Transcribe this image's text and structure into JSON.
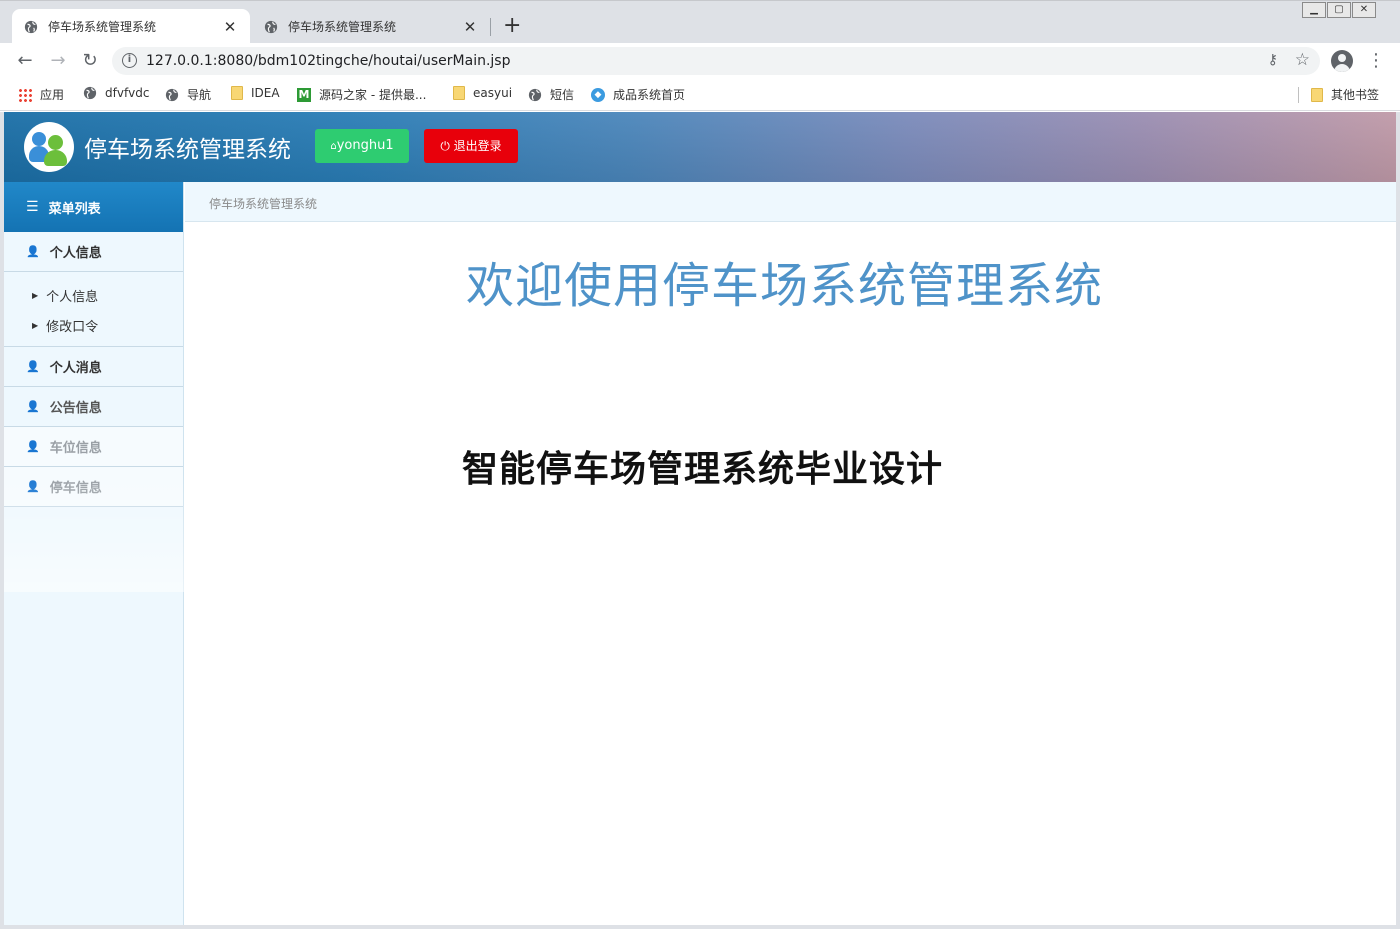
{
  "browser": {
    "tabs": [
      {
        "title": "停车场系统管理系统",
        "active": true
      },
      {
        "title": "停车场系统管理系统",
        "active": false
      }
    ],
    "url": "127.0.0.1:8080/bdm102tingche/houtai/userMain.jsp",
    "bookmarks": [
      {
        "label": "应用",
        "icon": "apps-grid-icon"
      },
      {
        "label": "dfvfvdc",
        "icon": "globe-icon"
      },
      {
        "label": "导航",
        "icon": "globe-icon"
      },
      {
        "label": "IDEA",
        "icon": "folder-icon"
      },
      {
        "label": "源码之家 - 提供最...",
        "icon": "m-site-icon"
      },
      {
        "label": "easyui",
        "icon": "folder-icon"
      },
      {
        "label": "短信",
        "icon": "globe-icon"
      },
      {
        "label": "成品系统首页",
        "icon": "site-icon"
      }
    ],
    "other_bookmarks": "其他书签"
  },
  "app": {
    "title": "停车场系统管理系统",
    "user_button": "yonghu1",
    "logout_button": "退出登录",
    "header_colors": {
      "start": "#1b6fa7",
      "end": "#c09aa8"
    },
    "user_button_color": "#2ecc71",
    "logout_button_color": "#e8000b"
  },
  "sidebar": {
    "header": "菜单列表",
    "groups": [
      {
        "label": "个人信息",
        "expanded": true,
        "items": [
          "个人信息",
          "修改口令"
        ]
      },
      {
        "label": "个人消息",
        "expanded": false,
        "items": []
      },
      {
        "label": "公告信息",
        "expanded": false,
        "items": []
      },
      {
        "label": "车位信息",
        "expanded": false,
        "items": []
      },
      {
        "label": "停车信息",
        "expanded": false,
        "items": []
      }
    ]
  },
  "main": {
    "breadcrumb": "停车场系统管理系统",
    "welcome": "欢迎使用停车场系统管理系统",
    "welcome_color": "#4f93c9"
  },
  "overlay": {
    "watermark_text": "智能停车场管理系统毕业设计"
  }
}
